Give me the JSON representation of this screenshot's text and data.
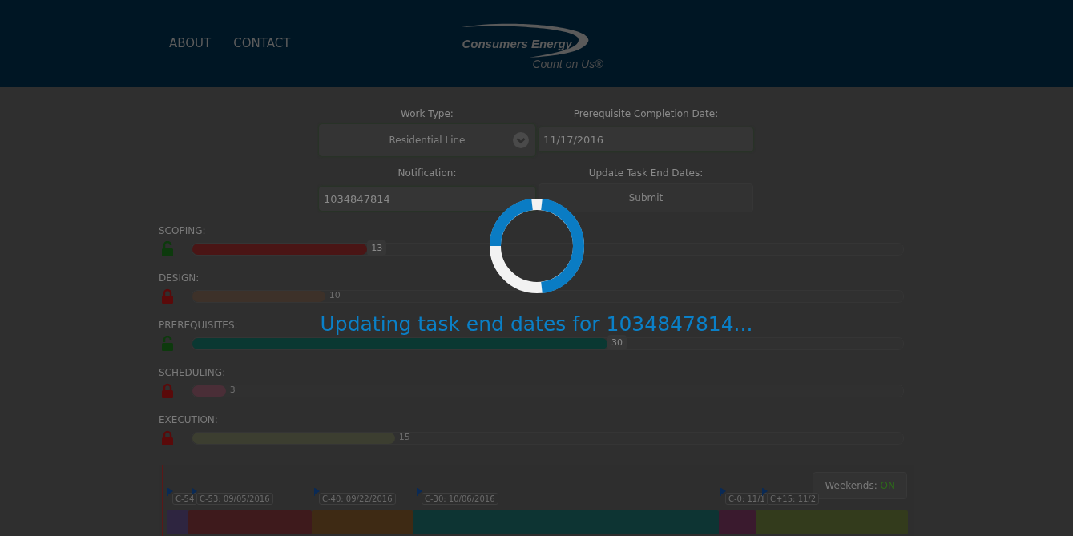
{
  "nav": {
    "links": [
      "ABOUT",
      "CONTACT"
    ]
  },
  "logo": {
    "name": "Consumers Energy",
    "tagline": "Count on Us®"
  },
  "form": {
    "work_type": {
      "label": "Work Type:",
      "value": "Residential Line"
    },
    "completion_date": {
      "label": "Prerequisite Completion Date:",
      "value": "11/17/2016"
    },
    "notification": {
      "label": "Notification:",
      "value": "1034847814"
    },
    "update": {
      "label": "Update Task End Dates:",
      "button": "Submit"
    }
  },
  "phases": [
    {
      "name": "SCOPING:",
      "locked": false,
      "level": 0.246,
      "reading": "13",
      "color": "#4a1515"
    },
    {
      "name": "DESIGN:",
      "locked": true,
      "level": 0.187,
      "reading": "10",
      "color": "#3d3129"
    },
    {
      "name": "PREREQUISITES:",
      "locked": false,
      "level": 0.584,
      "reading": "30",
      "color": "#0a3832"
    },
    {
      "name": "SCHEDULING:",
      "locked": true,
      "level": 0.047,
      "reading": "3",
      "color": "#4a2e37"
    },
    {
      "name": "EXECUTION:",
      "locked": true,
      "level": 0.285,
      "reading": "15",
      "color": "#3c3e30"
    }
  ],
  "timeline": {
    "weekends": {
      "label": "Weekends:",
      "value": "ON",
      "on": true
    },
    "milestones": [
      "C-54",
      "C-53: 09/05/2016",
      "C-40: 09/22/2016",
      "C-30: 10/06/2016",
      "C-0: 11/1",
      "C+15: 11/2"
    ],
    "segments": [
      {
        "color": "#2e2540"
      },
      {
        "color": "#3e1a1c"
      },
      {
        "color": "#3e2a14"
      },
      {
        "color": "#0d3433"
      },
      {
        "color": "#3a1a2e"
      },
      {
        "color": "#333b1c"
      }
    ]
  },
  "loading": {
    "message": "Updating task end dates for 1034847814..."
  }
}
